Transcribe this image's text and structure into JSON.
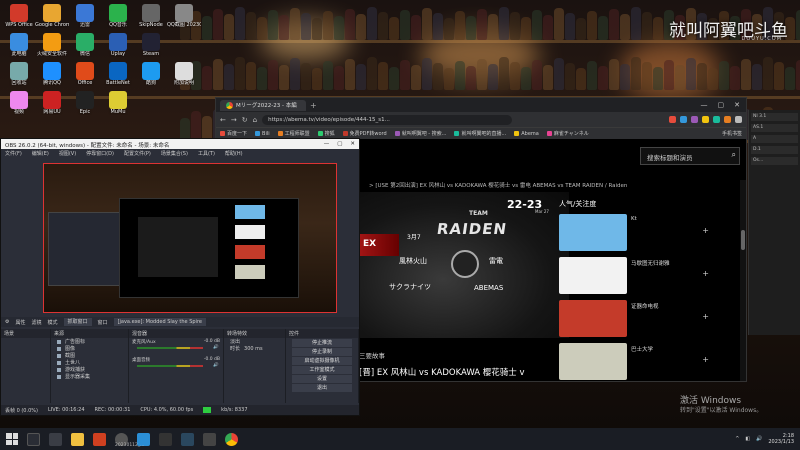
{
  "watermark": {
    "text": "就叫阿翼吧",
    "logo": "斗鱼",
    "sub": "DOUYU.COM"
  },
  "desktop_icons": [
    {
      "label": "WPS Office",
      "color": "#d23a2a",
      "col": 0,
      "row": 0
    },
    {
      "label": "Google Chrome",
      "color": "#e8a631",
      "col": 1,
      "row": 0
    },
    {
      "label": "迅雷",
      "color": "#3b78d6",
      "col": 2,
      "row": 0
    },
    {
      "label": "QQ音乐",
      "color": "#2bb24c",
      "col": 3,
      "row": 0
    },
    {
      "label": "SkipNode",
      "color": "#666",
      "col": 4,
      "row": 0
    },
    {
      "label": "QQ截图 20230113",
      "color": "#888",
      "col": 5,
      "row": 0
    },
    {
      "label": "此电脑",
      "color": "#3a8de0",
      "col": 0,
      "row": 1
    },
    {
      "label": "火绒安全软件",
      "color": "#f39c12",
      "col": 1,
      "row": 1
    },
    {
      "label": "微信",
      "color": "#2aae67",
      "col": 2,
      "row": 1
    },
    {
      "label": "Uplay",
      "color": "#2b5fb4",
      "col": 3,
      "row": 1
    },
    {
      "label": "Steam",
      "color": "#223",
      "col": 4,
      "row": 1
    },
    {
      "label": "回收站",
      "color": "#7aa",
      "col": 0,
      "row": 2
    },
    {
      "label": "腾讯QQ",
      "color": "#1e90ff",
      "col": 1,
      "row": 2
    },
    {
      "label": "Office",
      "color": "#e04b1a",
      "col": 2,
      "row": 2
    },
    {
      "label": "BattleNet",
      "color": "#0a66c2",
      "col": 3,
      "row": 2
    },
    {
      "label": "酷狗",
      "color": "#1d9bf0",
      "col": 4,
      "row": 2
    },
    {
      "label": "附加说明",
      "color": "#ddd",
      "col": 5,
      "row": 2
    },
    {
      "label": "视频",
      "color": "#e8e",
      "col": 0,
      "row": 3
    },
    {
      "label": "网易UU",
      "color": "#c22",
      "col": 1,
      "row": 3
    },
    {
      "label": "Epic",
      "color": "#222",
      "col": 2,
      "row": 3
    },
    {
      "label": "MuMu",
      "color": "#dc3",
      "col": 3,
      "row": 3
    }
  ],
  "browser": {
    "tab_title": "Mリーグ2022-23 - 本編",
    "url": "https://abema.tv/video/episode/444-15_s1...",
    "bookmarks": [
      "百度一下",
      "Bili",
      "工程师联盟",
      "搜狐",
      "免费PDF转word",
      "就叫啊翼吧 - 搜索...",
      "就叫啊翼吧的直播...",
      "Abema",
      "麻雀チャンネル"
    ],
    "bookmark_tail": "手机书签",
    "search_placeholder": "搜索标题和演员",
    "breadcrumb": "> [USE 第2回出演] EX 风林山 vs KADOKAWA 樱花骑士 vs 雷电 ABEMAS vs TEAM RAIDEN / Raiden",
    "video": {
      "logo": "22-23",
      "logo_sub": "Mar 27",
      "team_name": "RAIDEN",
      "team_prefix": "TEAM",
      "left_badge": "EX",
      "teams": [
        "風林火山",
        "雷電",
        "サクラナイツ",
        "ABEMAS"
      ],
      "round": "3月7"
    },
    "section": "三要故事",
    "title": "[晋] EX 风林山 vs KADOKAWA 樱花骑士 v",
    "popular_header": "人气/关注度",
    "popular": [
      {
        "name": "Kt",
        "color": "#6fb8e8"
      },
      {
        "name": "马歇图无归谢雅",
        "color": "#f2f2f2"
      },
      {
        "name": "证器命电视",
        "color": "#c43b2a"
      },
      {
        "name": "巴士大学",
        "color": "#ccb"
      }
    ]
  },
  "side_panel": [
    "NI 3.1",
    "AS.1",
    "A",
    "D.1",
    "Os..."
  ],
  "obs": {
    "title": "OBS 26.0.2 (64-bit, windows) - 配置文件: 未命名 - 场景: 未命名",
    "menu": [
      "文件(F)",
      "编辑(E)",
      "视图(V)",
      "停靠窗口(D)",
      "配置文件(P)",
      "场景集合(S)",
      "工具(T)",
      "帮助(H)"
    ],
    "toolbar": {
      "props": "属性",
      "filters": "滤镜",
      "mode": "模式",
      "source": "抓取窗口",
      "window_label": "窗口",
      "window_value": "[java.exe]: Modded Slay the Spire"
    },
    "docks": {
      "scenes": "场景",
      "sources": "来源",
      "mixer": "混音器",
      "transitions": "转场特效",
      "controls": "控件"
    },
    "sources": [
      "广告图标",
      "图像",
      "截图",
      "土世八",
      "游戏捕获",
      "显示器采集"
    ],
    "mixer": [
      {
        "name": "麦克风/Aux",
        "db": "-0.0 dB"
      },
      {
        "name": "桌面音频",
        "db": "-0.0 dB"
      }
    ],
    "transition": {
      "label": "淡出",
      "duration_label": "时长",
      "duration": "300 ms"
    },
    "controls": [
      "停止推流",
      "停止录制",
      "启动虚拟摄像机",
      "工作室模式",
      "设置",
      "退出"
    ],
    "status": {
      "dropped": "丢帧 0 (0.0%)",
      "live": "LIVE: 00:16:24",
      "rec": "REC: 00:00:31",
      "cpu": "CPU: 4.0%, 60.00 fps",
      "kbps": "kb/s: 8337"
    }
  },
  "activation": {
    "title": "激活 Windows",
    "sub": "转到\"设置\"以激活 Windows。"
  },
  "taskbar": {
    "time": "2:18",
    "date": "2023/1/13",
    "label": "20230112_..."
  }
}
